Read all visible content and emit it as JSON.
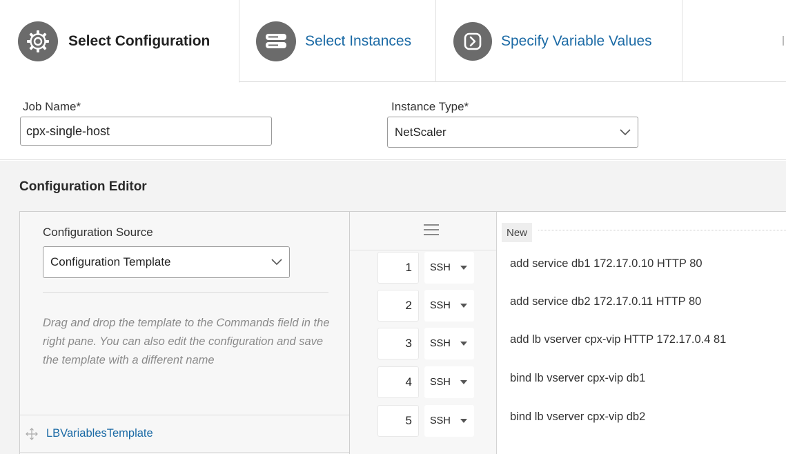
{
  "tabs": [
    {
      "label": "Select Configuration",
      "icon": "gear-icon",
      "active": true
    },
    {
      "label": "Select Instances",
      "icon": "server-icon",
      "active": false
    },
    {
      "label": "Specify Variable Values",
      "icon": "arrow-right-icon",
      "active": false
    }
  ],
  "form": {
    "job_name_label": "Job Name*",
    "job_name_value": "cpx-single-host",
    "instance_type_label": "Instance Type*",
    "instance_type_value": "NetScaler"
  },
  "editor": {
    "title": "Configuration Editor",
    "source_label": "Configuration Source",
    "source_value": "Configuration Template",
    "hint": "Drag and drop the template to the Commands field in the right pane. You can also edit the configuration and save the template with a different name",
    "template_name": "LBVariablesTemplate",
    "new_badge": "New",
    "commands": [
      {
        "num": "1",
        "protocol": "SSH",
        "text": "add service db1 172.17.0.10 HTTP 80"
      },
      {
        "num": "2",
        "protocol": "SSH",
        "text": "add service db2 172.17.0.11 HTTP 80"
      },
      {
        "num": "3",
        "protocol": "SSH",
        "text": "add lb vserver cpx-vip HTTP 172.17.0.4 81"
      },
      {
        "num": "4",
        "protocol": "SSH",
        "text": "bind lb vserver cpx-vip db1"
      },
      {
        "num": "5",
        "protocol": "SSH",
        "text": "bind lb vserver cpx-vip db2"
      }
    ]
  },
  "colors": {
    "link": "#1b6aa5",
    "tab_icon_bg": "#6b6b6b",
    "editor_bg": "#f3f3f3"
  }
}
